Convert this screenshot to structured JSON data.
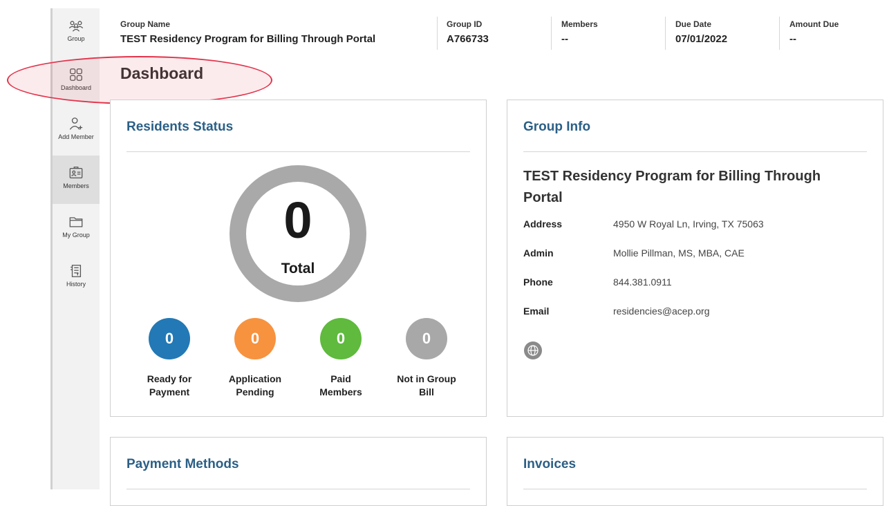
{
  "sidebar": {
    "items": [
      {
        "label": "Group",
        "icon": "group-icon"
      },
      {
        "label": "Dashboard",
        "icon": "dashboard-icon"
      },
      {
        "label": "Add Member",
        "icon": "add-member-icon"
      },
      {
        "label": "Members",
        "icon": "members-icon",
        "active": true
      },
      {
        "label": "My Group",
        "icon": "folder-icon"
      },
      {
        "label": "History",
        "icon": "history-icon"
      }
    ]
  },
  "header": {
    "group_name_label": "Group Name",
    "group_name": "TEST Residency Program for Billing Through Portal",
    "group_id_label": "Group ID",
    "group_id": "A766733",
    "members_label": "Members",
    "members": "--",
    "due_date_label": "Due Date",
    "due_date": "07/01/2022",
    "amount_due_label": "Amount Due",
    "amount_due": "--"
  },
  "page": {
    "title": "Dashboard"
  },
  "residents_status": {
    "title": "Residents Status",
    "total": "0",
    "total_label": "Total",
    "stats": [
      {
        "value": "0",
        "line1": "Ready for",
        "line2": "Payment",
        "color": "#2279b5"
      },
      {
        "value": "0",
        "line1": "Application",
        "line2": "Pending",
        "color": "#f7923f"
      },
      {
        "value": "0",
        "line1": "Paid",
        "line2": "Members",
        "color": "#5fba3d"
      },
      {
        "value": "0",
        "line1": "Not in Group",
        "line2": "Bill",
        "color": "#a8a8a8"
      }
    ]
  },
  "group_info": {
    "title": "Group Info",
    "name_line1": "TEST Residency Program for Billing Through",
    "name_line2": "Portal",
    "address_label": "Address",
    "address": "4950 W Royal Ln, Irving, TX 75063",
    "admin_label": "Admin",
    "admin": "Mollie Pillman, MS, MBA, CAE",
    "phone_label": "Phone",
    "phone": "844.381.0911",
    "email_label": "Email",
    "email": "residencies@acep.org"
  },
  "payment_methods": {
    "title": "Payment Methods"
  },
  "invoices": {
    "title": "Invoices"
  },
  "colors": {
    "accent_title": "#2b5f86",
    "highlight_oval": "#e2334a",
    "donut_ring": "#a9a9a9"
  }
}
